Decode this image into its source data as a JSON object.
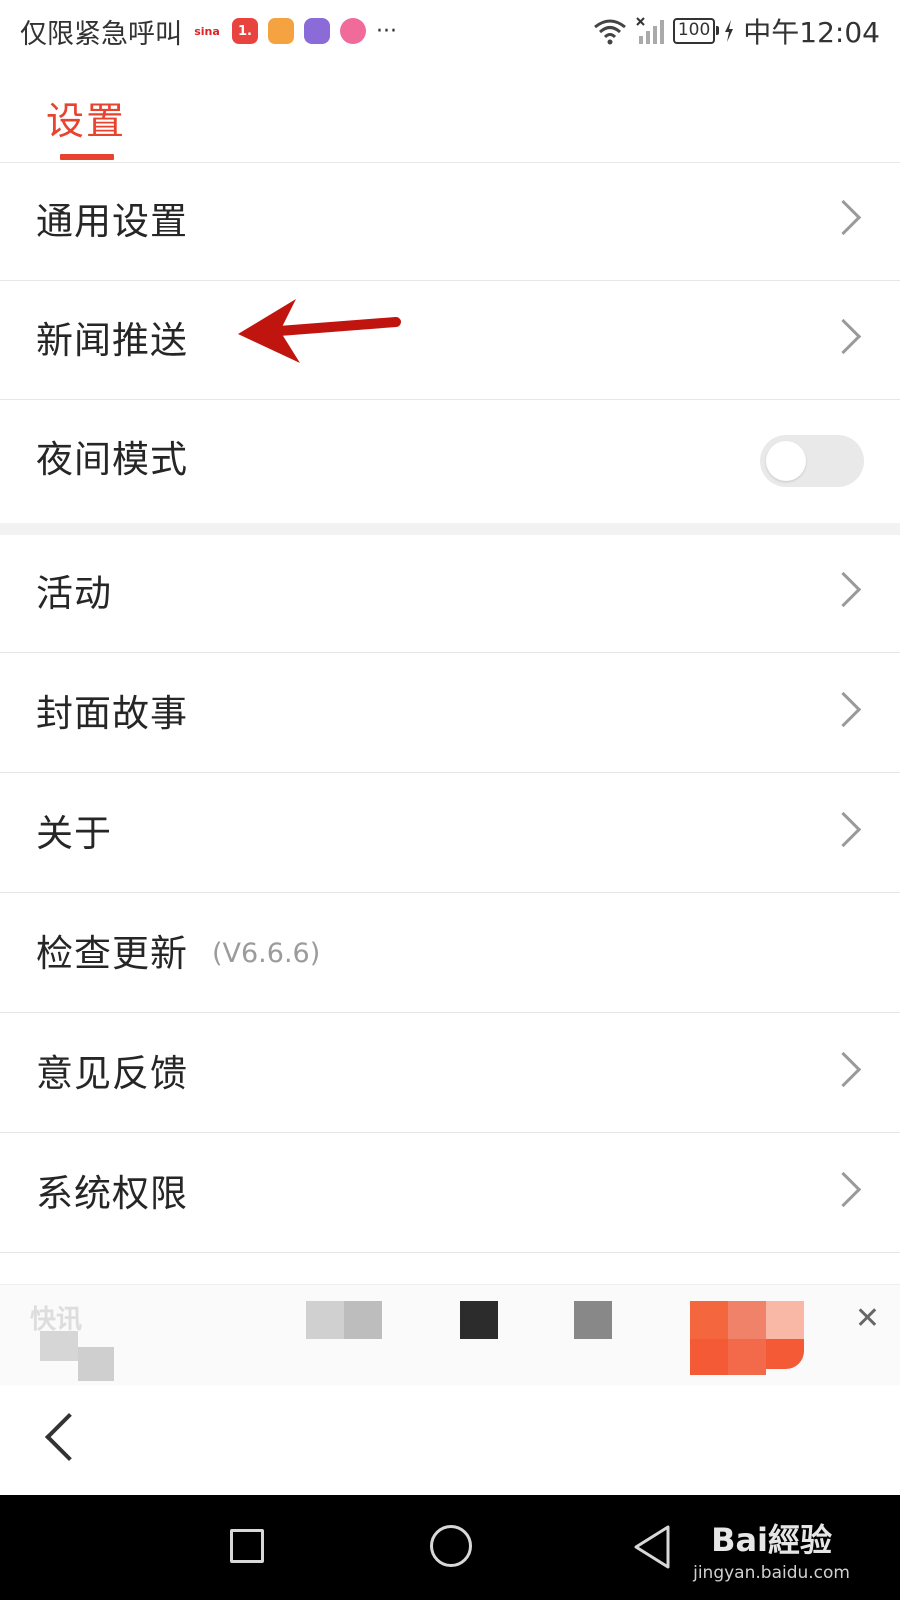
{
  "status_bar": {
    "left_text": "仅限紧急呼叫",
    "battery": "100",
    "clock": "中午12:04",
    "app_icons": [
      "sina-icon",
      "app-1-icon",
      "weibo-icon",
      "browser-icon",
      "chat-icon"
    ],
    "more": "···"
  },
  "header": {
    "title": "设置",
    "accent_color": "#e8432e"
  },
  "settings": {
    "general": "通用设置",
    "push": "新闻推送",
    "night_mode": "夜间模式",
    "night_mode_on": false,
    "activity": "活动",
    "cover_story": "封面故事",
    "about": "关于",
    "check_update": "检查更新",
    "version": "(V6.6.6)",
    "feedback": "意见反馈",
    "permissions": "系统权限"
  },
  "ad_banner": {
    "label": "快讯",
    "close": "✕"
  },
  "watermark": {
    "brand": "Bai經验",
    "sub": "jingyan.baidu.com"
  }
}
